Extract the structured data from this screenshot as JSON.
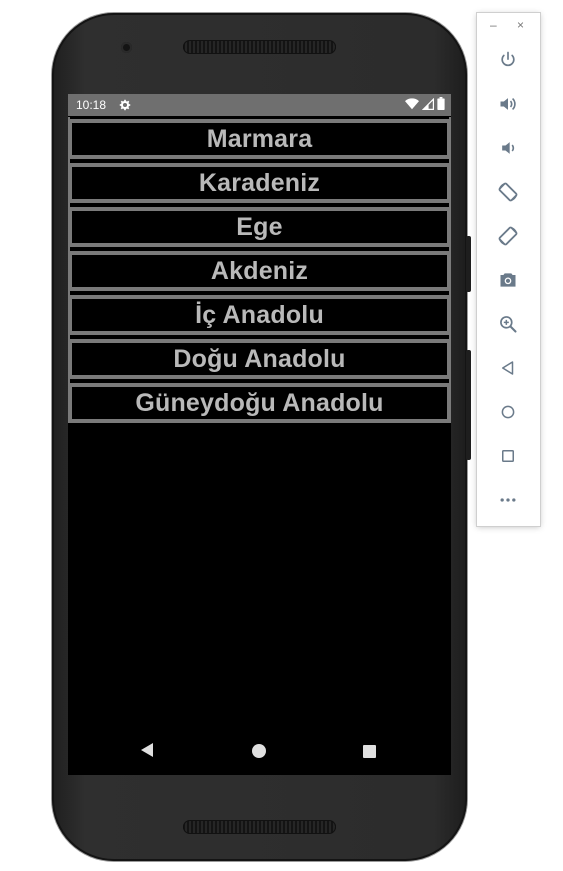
{
  "status_bar": {
    "time": "10:18",
    "icons": [
      "settings-icon",
      "wifi-icon",
      "signal-icon",
      "battery-icon"
    ]
  },
  "regions": [
    {
      "label": "Marmara"
    },
    {
      "label": "Karadeniz"
    },
    {
      "label": "Ege"
    },
    {
      "label": "Akdeniz"
    },
    {
      "label": "İç Anadolu"
    },
    {
      "label": "Doğu Anadolu"
    },
    {
      "label": "Güneydoğu Anadolu"
    }
  ],
  "nav_bar": {
    "icons": [
      "back-icon",
      "home-icon",
      "recents-icon"
    ]
  },
  "emulator_toolbar": {
    "window_controls": {
      "minimize": "–",
      "close": "×"
    },
    "tools": [
      "power-icon",
      "volume-up-icon",
      "volume-down-icon",
      "rotate-left-icon",
      "rotate-right-icon",
      "screenshot-icon",
      "zoom-icon",
      "back-icon",
      "home-icon",
      "overview-icon",
      "more-icon"
    ]
  },
  "colors": {
    "button_border": "#7a7a7a",
    "button_text": "#b9b9b9",
    "screen_background": "#000000",
    "status_bar": "#6f6f6f",
    "toolbar_icon": "#6a7a8a"
  }
}
